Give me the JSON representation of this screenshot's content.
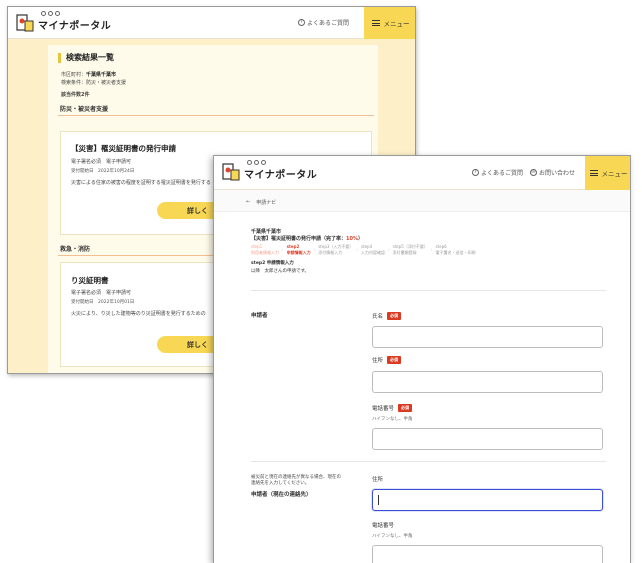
{
  "brand": {
    "logo_text": "マイナポータル"
  },
  "header": {
    "faq": "よくあるご質問",
    "contact": "お問い合わせ",
    "menu": "メニュー"
  },
  "back": {
    "title": "検索結果一覧",
    "municipality_label": "市区町村：",
    "municipality": "千葉県千葉市",
    "condition_label": "検索条件：",
    "condition": "防災・被災者支援",
    "count": "該当件数2件",
    "section1": "防災・被災者支援",
    "card1": {
      "title": "【災害】罹災証明書の発行申請",
      "tags": "電子署名必須　電子申請可",
      "date": "受付開始日　2022年10月24日",
      "desc": "災害による住家の被害の程度を証明する罹災証明書を発行する",
      "button": "詳しく"
    },
    "section2": "救急・消防",
    "card2": {
      "title": "り災証明書",
      "tags": "電子署名必須　電子申請可",
      "date": "受付開始日　2022年10月01日",
      "desc": "火災により、り災した建物等のり災証明書を発行するための",
      "button": "詳しく"
    }
  },
  "front": {
    "back_link_arrow": "←",
    "back_link": "申請ナビ",
    "municipality": "千葉県千葉市",
    "application": "【災害】罹災証明書の発行申請（完了率：",
    "percent": "10%",
    "application_close": "）",
    "steps": [
      {
        "num": "step1",
        "label": "利用者情報入力",
        "state": "done"
      },
      {
        "num": "step2",
        "label": "申請情報入力",
        "state": "active"
      },
      {
        "num": "step3（入力不要）",
        "label": "添付情報入力",
        "state": "todo"
      },
      {
        "num": "step4",
        "label": "入力内容確認",
        "state": "todo"
      },
      {
        "num": "step5（添付不要）",
        "label": "添付書類登録",
        "state": "todo"
      },
      {
        "num": "step6",
        "label": "電子署名・送信・印刷",
        "state": "todo"
      }
    ],
    "step_arrow": "›",
    "step_title": "step2 申請情報入力",
    "step_sub": "以降　太郎さんの申請です。",
    "group1": "申請者",
    "name_label": "氏名",
    "address_label": "住所",
    "phone_label": "電話番号",
    "phone_help": "ハイフンなし、半角",
    "required": "必須",
    "group2_note1": "被災前と現在の連絡先が異なる場合、現在の",
    "group2_note2": "連絡先を入力してください。",
    "group2": "申請者（現在の連絡先）",
    "address2_label": "住所",
    "phone2_label": "電話番号",
    "phone2_help": "ハイフンなし、半角"
  }
}
